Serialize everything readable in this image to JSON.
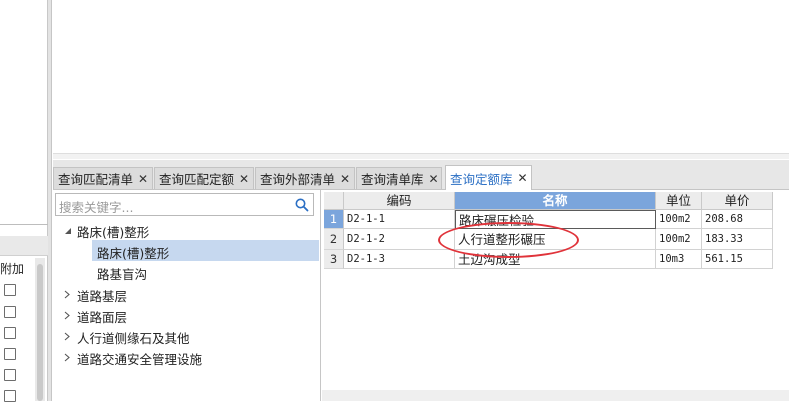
{
  "left_panel": {
    "column_label": "附加"
  },
  "tabs": [
    {
      "label": "查询匹配清单",
      "close": "✕"
    },
    {
      "label": "查询匹配定额",
      "close": "✕"
    },
    {
      "label": "查询外部清单",
      "close": "✕"
    },
    {
      "label": "查询清单库",
      "close": "✕"
    },
    {
      "label": "查询定额库",
      "close": "✕",
      "active": true
    }
  ],
  "search": {
    "placeholder": "搜索关键字...",
    "icon": "search-icon"
  },
  "tree": {
    "items": [
      {
        "label": "路床(槽)整形",
        "expanded": true
      },
      {
        "label": "路床(槽)整形",
        "selected": true
      },
      {
        "label": "路基盲沟"
      },
      {
        "label": "道路基层",
        "expanded": false
      },
      {
        "label": "道路面层",
        "expanded": false
      },
      {
        "label": "人行道侧缘石及其他",
        "expanded": false
      },
      {
        "label": "道路交通安全管理设施",
        "expanded": false
      }
    ]
  },
  "grid": {
    "headers": [
      "编码",
      "名称",
      "单位",
      "单价"
    ],
    "rows": [
      {
        "num": "1",
        "code": "D2-1-1",
        "name": "路床碾压检验",
        "unit": "100m2",
        "price": "208.68"
      },
      {
        "num": "2",
        "code": "D2-1-2",
        "name": "人行道整形碾压",
        "unit": "100m2",
        "price": "183.33"
      },
      {
        "num": "3",
        "code": "D2-1-3",
        "name": "土边沟成型",
        "unit": "10m3",
        "price": "561.15"
      }
    ]
  },
  "colors": {
    "accent": "#2b6fc4",
    "header_selected": "#7ba5dc",
    "tree_selected": "#c6d8ef",
    "annotation": "#e0333a"
  }
}
